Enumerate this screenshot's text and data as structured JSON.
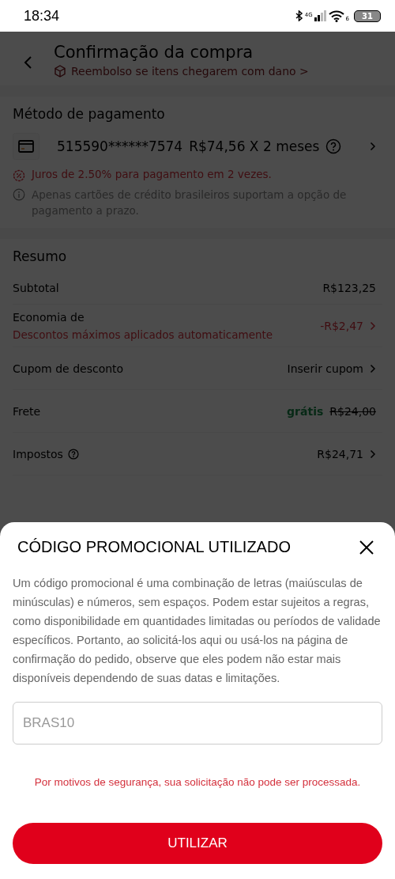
{
  "status_bar": {
    "time": "18:34",
    "network": "4G",
    "wifi_label": "6",
    "battery": "31"
  },
  "header": {
    "title": "Confirmação da compra",
    "subtitle": "Reembolso se itens chegarem com dano >"
  },
  "payment": {
    "heading": "Método de pagamento",
    "card": "515590******7574",
    "installment": "R$74,56 X 2 meses",
    "interest": "Juros de 2.50% para pagamento em 2 vezes.",
    "note": "Apenas cartões de crédito brasileiros suportam a opção de pagamento a prazo."
  },
  "summary": {
    "heading": "Resumo",
    "rows": [
      {
        "kind": "plain",
        "label": "Subtotal",
        "value": "R$123,25"
      },
      {
        "kind": "discount",
        "label": "Economia de",
        "detail": "Descontos máximos aplicados automaticamente",
        "value": "-R$2,47"
      },
      {
        "kind": "link",
        "label": "Cupom de desconto",
        "value": "Inserir cupom"
      },
      {
        "kind": "free",
        "label": "Frete",
        "free": "grátis",
        "value": "R$24,00"
      },
      {
        "kind": "help",
        "label": "Impostos",
        "value": "R$24,71"
      }
    ]
  },
  "sheet": {
    "title": "CÓDIGO PROMOCIONAL UTILIZADO",
    "body": "Um código promocional é uma combinação de letras (maiúsculas de minúsculas) e números, sem espaços. Podem estar sujeitos a regras, como disponibilidade em quantidades limitadas ou períodos de validade específicos. Portanto, ao solicitá-los aqui ou usá-los na página de confirmação do pedido, observe que eles podem não estar mais disponíveis dependendo de suas datas e limitações.",
    "code": "BRAS10",
    "error": "Por motivos de segurança, sua solicitação não pode ser processada.",
    "button": "UTILIZAR"
  }
}
